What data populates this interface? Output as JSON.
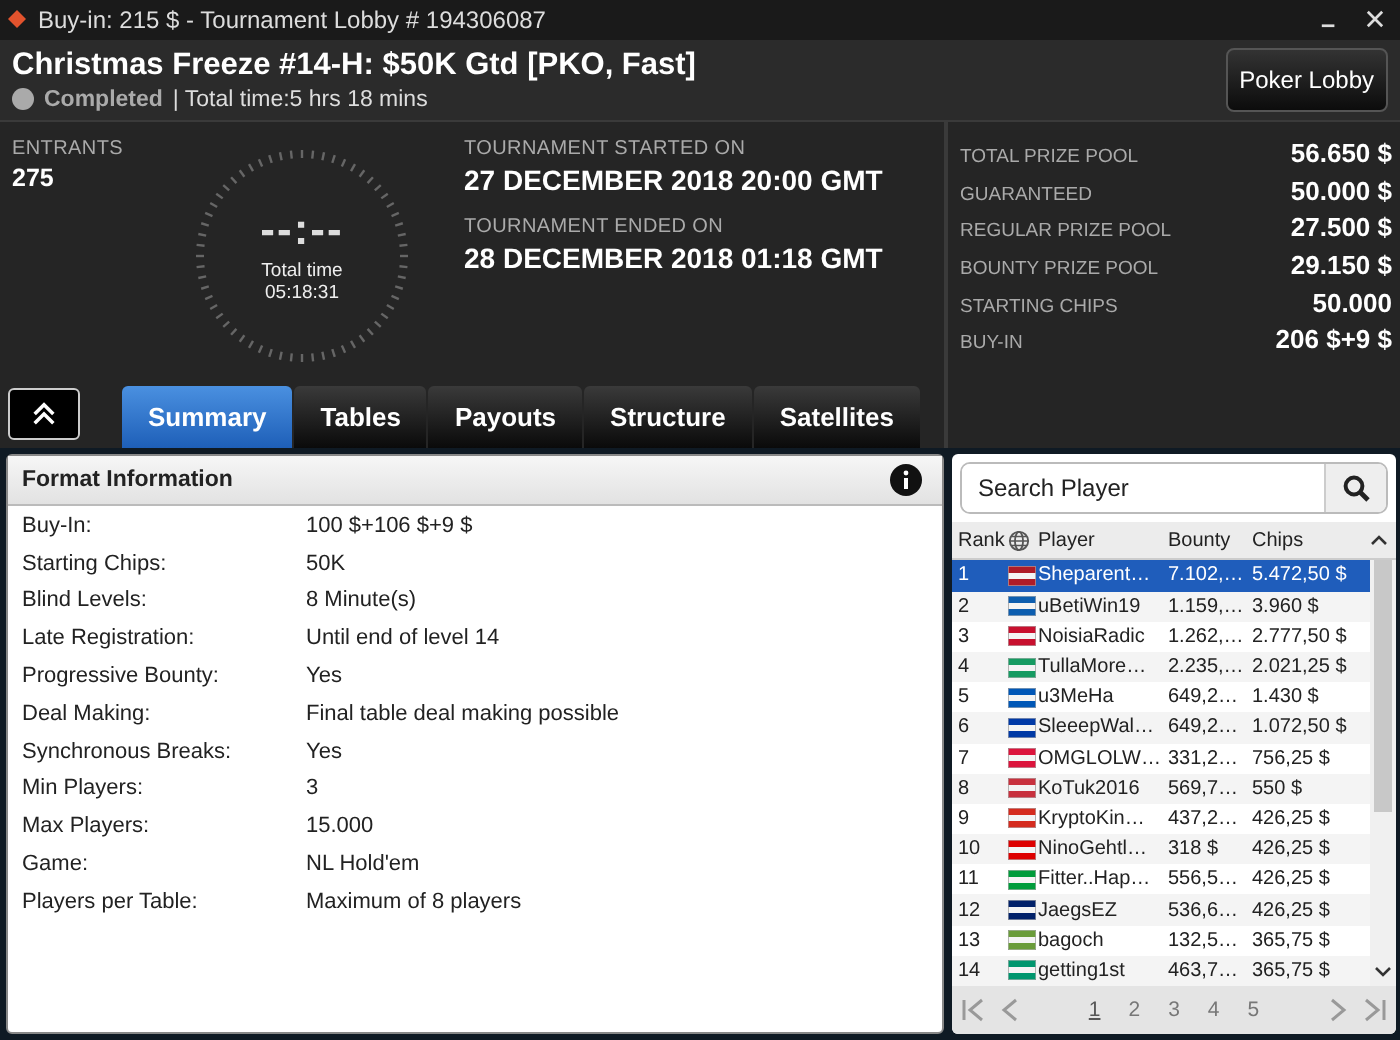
{
  "window": {
    "title": "Buy-in: 215 $ - Tournament Lobby # 194306087"
  },
  "tournament": {
    "name": "Christmas Freeze #14-H: $50K Gtd [PKO, Fast]",
    "status": "Completed",
    "total_time": "| Total time:5 hrs  18 mins"
  },
  "poker_lobby_button": "Poker Lobby",
  "entrants": {
    "label": "ENTRANTS",
    "value": "275"
  },
  "clock": {
    "display": "--:--",
    "label": "Total time",
    "value": "05:18:31"
  },
  "dates": [
    {
      "label": "TOURNAMENT STARTED ON",
      "value": "27 DECEMBER 2018  20:00 GMT"
    },
    {
      "label": "TOURNAMENT ENDED ON",
      "value": "28 DECEMBER 2018  01:18 GMT"
    }
  ],
  "prize_info": [
    {
      "label": "TOTAL PRIZE POOL",
      "value": "56.650 $"
    },
    {
      "label": "GUARANTEED",
      "value": "50.000 $"
    },
    {
      "label": "REGULAR PRIZE POOL",
      "value": "27.500 $"
    },
    {
      "label": "BOUNTY PRIZE POOL",
      "value": "29.150 $"
    },
    {
      "label": "STARTING CHIPS",
      "value": "50.000"
    },
    {
      "label": "BUY-IN",
      "value": "206 $+9 $"
    }
  ],
  "tabs": [
    {
      "label": "Summary",
      "selected": true
    },
    {
      "label": "Tables",
      "selected": false
    },
    {
      "label": "Payouts",
      "selected": false
    },
    {
      "label": "Structure",
      "selected": false
    },
    {
      "label": "Satellites",
      "selected": false
    }
  ],
  "format_info": {
    "title": "Format Information",
    "rows": [
      {
        "label": "Buy-In:",
        "value": "100 $+106 $+9 $"
      },
      {
        "label": "Starting Chips:",
        "value": "50K"
      },
      {
        "label": "Blind Levels:",
        "value": "8 Minute(s)"
      },
      {
        "label": "Late Registration:",
        "value": "Until end of level 14"
      },
      {
        "label": "Progressive Bounty:",
        "value": "Yes"
      },
      {
        "label": "Deal Making:",
        "value": "Final table deal making possible"
      },
      {
        "label": "Synchronous Breaks:",
        "value": "Yes"
      },
      {
        "label": "Min Players:",
        "value": "3"
      },
      {
        "label": "Max Players:",
        "value": "15.000"
      },
      {
        "label": "Game:",
        "value": "NL Hold'em"
      },
      {
        "label": "Players per Table:",
        "value": "Maximum of 8 players"
      }
    ]
  },
  "player_search": {
    "placeholder": "Search Player"
  },
  "player_table": {
    "columns": [
      "Rank",
      "Player",
      "Bounty",
      "Chips"
    ],
    "rows": [
      {
        "rank": "1",
        "color": "#ae1c28",
        "player": "Sheparent…",
        "bounty": "7.102,…",
        "chips": "5.472,50 $",
        "selected": true
      },
      {
        "rank": "2",
        "color": "#0d5eaf",
        "player": "uBetiWin19",
        "bounty": "1.159,…",
        "chips": "3.960 $",
        "selected": false
      },
      {
        "rank": "3",
        "color": "#c8102e",
        "player": "NoisiaRadic",
        "bounty": "1.262,…",
        "chips": "2.777,50 $",
        "selected": false
      },
      {
        "rank": "4",
        "color": "#169b62",
        "player": "TullaMore…",
        "bounty": "2.235,…",
        "chips": "2.021,25 $",
        "selected": false
      },
      {
        "rank": "5",
        "color": "#0057b7",
        "player": "u3MeHa",
        "bounty": "649,2…",
        "chips": "1.430 $",
        "selected": false
      },
      {
        "rank": "6",
        "color": "#0039a6",
        "player": "SleeepWal…",
        "bounty": "649,2…",
        "chips": "1.072,50 $",
        "selected": false
      },
      {
        "rank": "7",
        "color": "#dc143c",
        "player": "OMGLOLW…",
        "bounty": "331,2…",
        "chips": "756,25 $",
        "selected": false
      },
      {
        "rank": "8",
        "color": "#c8313e",
        "player": "KoTuk2016",
        "bounty": "569,7…",
        "chips": "550 $",
        "selected": false
      },
      {
        "rank": "9",
        "color": "#d52b1e",
        "player": "KryptoKin…",
        "bounty": "437,2…",
        "chips": "426,25 $",
        "selected": false
      },
      {
        "rank": "10",
        "color": "#dd0000",
        "player": "NinoGehtl…",
        "bounty": "318 $",
        "chips": "426,25 $",
        "selected": false
      },
      {
        "rank": "11",
        "color": "#009c3b",
        "player": "Fitter..Hap…",
        "bounty": "556,5…",
        "chips": "426,25 $",
        "selected": false
      },
      {
        "rank": "12",
        "color": "#012169",
        "player": "JaegsEZ",
        "bounty": "536,6…",
        "chips": "426,25 $",
        "selected": false
      },
      {
        "rank": "13",
        "color": "#6a9c3a",
        "player": "bagoch",
        "bounty": "132,5…",
        "chips": "365,75 $",
        "selected": false
      },
      {
        "rank": "14",
        "color": "#00966e",
        "player": "getting1st",
        "bounty": "463,7…",
        "chips": "365,75 $",
        "selected": false
      }
    ]
  },
  "pagination": [
    {
      "label": "1",
      "selected": true
    },
    {
      "label": "2",
      "selected": false
    },
    {
      "label": "3",
      "selected": false
    },
    {
      "label": "4",
      "selected": false
    },
    {
      "label": "5",
      "selected": false
    }
  ]
}
